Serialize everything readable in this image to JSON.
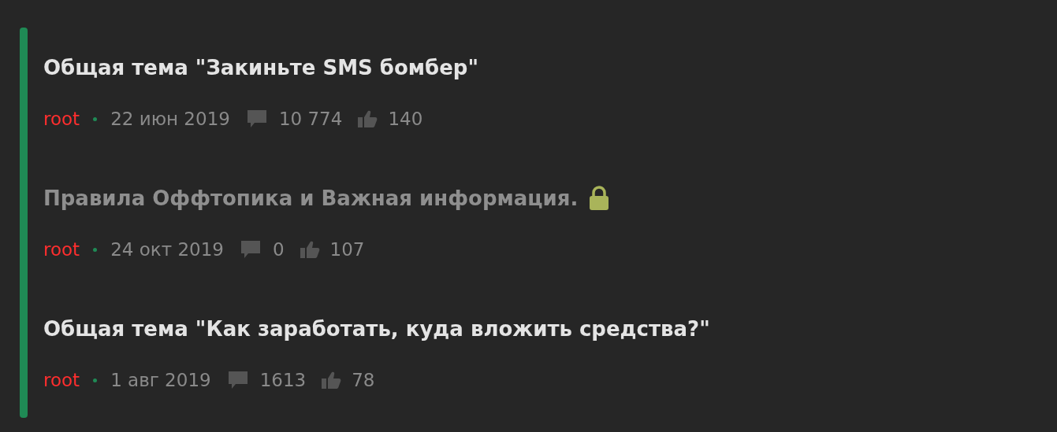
{
  "threads": [
    {
      "title": "Общая тема \"Закиньте SMS бомбер\"",
      "locked": false,
      "author": "root",
      "date": "22 июн 2019",
      "replies": "10 774",
      "likes": "140"
    },
    {
      "title": "Правила Оффтопика и Важная информация.",
      "locked": true,
      "author": "root",
      "date": "24 окт 2019",
      "replies": "0",
      "likes": "107"
    },
    {
      "title": "Общая тема \"Как заработать, куда вложить средства?\"",
      "locked": false,
      "author": "root",
      "date": "1 авг 2019",
      "replies": "1613",
      "likes": "78"
    }
  ]
}
